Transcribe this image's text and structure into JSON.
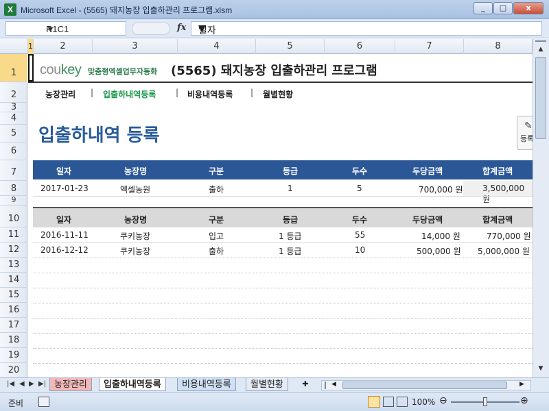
{
  "window": {
    "title": "Microsoft Excel - (5565) 돼지농장 입출하관리 프로그램.xlsm",
    "app_icon": "X",
    "buttons": {
      "minimize": "_",
      "restore": "□",
      "close": "x"
    }
  },
  "formula_bar": {
    "name_box": "R1C1",
    "fx": "fx",
    "content": "일자"
  },
  "columns": [
    "1",
    "2",
    "3",
    "4",
    "5",
    "6",
    "7",
    "8"
  ],
  "rows": [
    "1",
    "2",
    "3",
    "4",
    "5",
    "6",
    "7",
    "8",
    "9",
    "10",
    "11",
    "12",
    "13",
    "14",
    "15",
    "16",
    "17",
    "18",
    "19",
    "20"
  ],
  "brand": {
    "logo_main": "cou",
    "logo_accent": "key",
    "tagline": "맞춤형엑셀업무자동화"
  },
  "program_title": "(5565) 돼지농장 입출하관리 프로그램",
  "nav": [
    "농장관리",
    "입출하내역등록",
    "비용내역등록",
    "월별현황"
  ],
  "section_title": "입출하내역 등록",
  "register_button": {
    "label": "등록",
    "icon": "pencil-icon"
  },
  "headers": [
    "일자",
    "농장명",
    "구분",
    "등급",
    "두수",
    "두당금액",
    "합계금액"
  ],
  "input_row": [
    "2017-01-23",
    "엑셀농원",
    "출하",
    "1",
    "5",
    "700,000 원",
    "3,500,000 원"
  ],
  "records": [
    [
      "2016-11-11",
      "쿠키농장",
      "입고",
      "1 등급",
      "55",
      "14,000 원",
      "770,000 원"
    ],
    [
      "2016-12-12",
      "쿠키농장",
      "출하",
      "1 등급",
      "10",
      "500,000 원",
      "5,000,000 원"
    ]
  ],
  "sheet_tabs": [
    "농장관리",
    "입출하내역등록",
    "비용내역등록",
    "월별현황"
  ],
  "status": {
    "ready": "준비",
    "zoom": "100%",
    "zoom_fraction": 0.5
  },
  "colors": {
    "header_blue": "#2b5797",
    "header_gray": "#d9d9d9",
    "accent_green": "#3b8f5b"
  }
}
